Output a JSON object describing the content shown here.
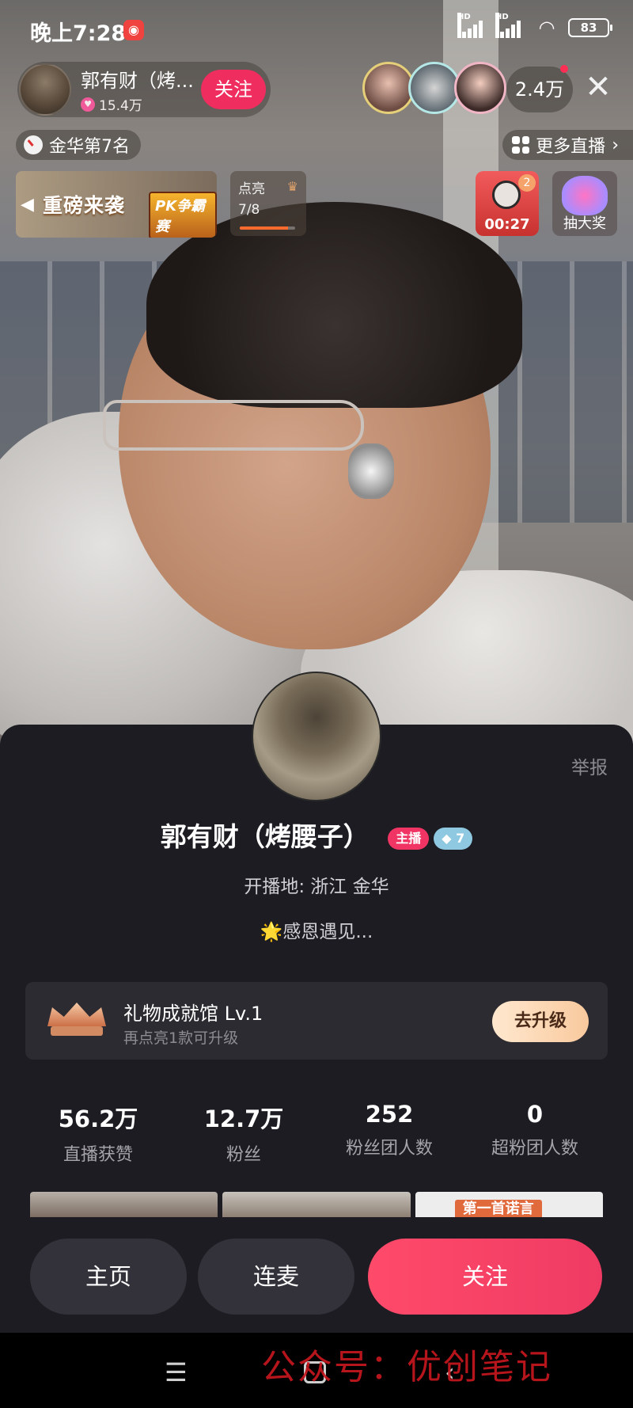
{
  "status_bar": {
    "time": "晚上7:28",
    "battery": "83"
  },
  "host": {
    "name": "郭有财（烤...",
    "likes": "15.4万",
    "follow_label": "关注"
  },
  "viewers": {
    "count": "2.4万"
  },
  "rank": {
    "label": "金华第7名"
  },
  "more_live": {
    "label": "更多直播"
  },
  "pk_banner": {
    "title": "重磅来袭",
    "logo": "PK争霸赛"
  },
  "light_up": {
    "label": "点亮",
    "progress": "7/8",
    "fraction": 0.875
  },
  "timer": {
    "badge": "2",
    "time": "00:27"
  },
  "lottery": {
    "label": "抽大奖"
  },
  "profile": {
    "report": "举报",
    "name": "郭有财（烤腰子）",
    "host_badge": "主播",
    "level_badge": "7",
    "location": "开播地: 浙江 金华",
    "bio": "🌟感恩遇见..."
  },
  "achievement": {
    "title": "礼物成就馆 Lv.1",
    "subtitle": "再点亮1款可升级",
    "button": "去升级"
  },
  "stats": [
    {
      "value": "56.2万",
      "label": "直播获赞"
    },
    {
      "value": "12.7万",
      "label": "粉丝"
    },
    {
      "value": "252",
      "label": "粉丝团人数"
    },
    {
      "value": "0",
      "label": "超粉团人数"
    }
  ],
  "videos": {
    "third_caption": "第一首诺言"
  },
  "actions": {
    "home": "主页",
    "mic": "连麦",
    "follow": "关注"
  },
  "watermark": "公众号：优创笔记"
}
